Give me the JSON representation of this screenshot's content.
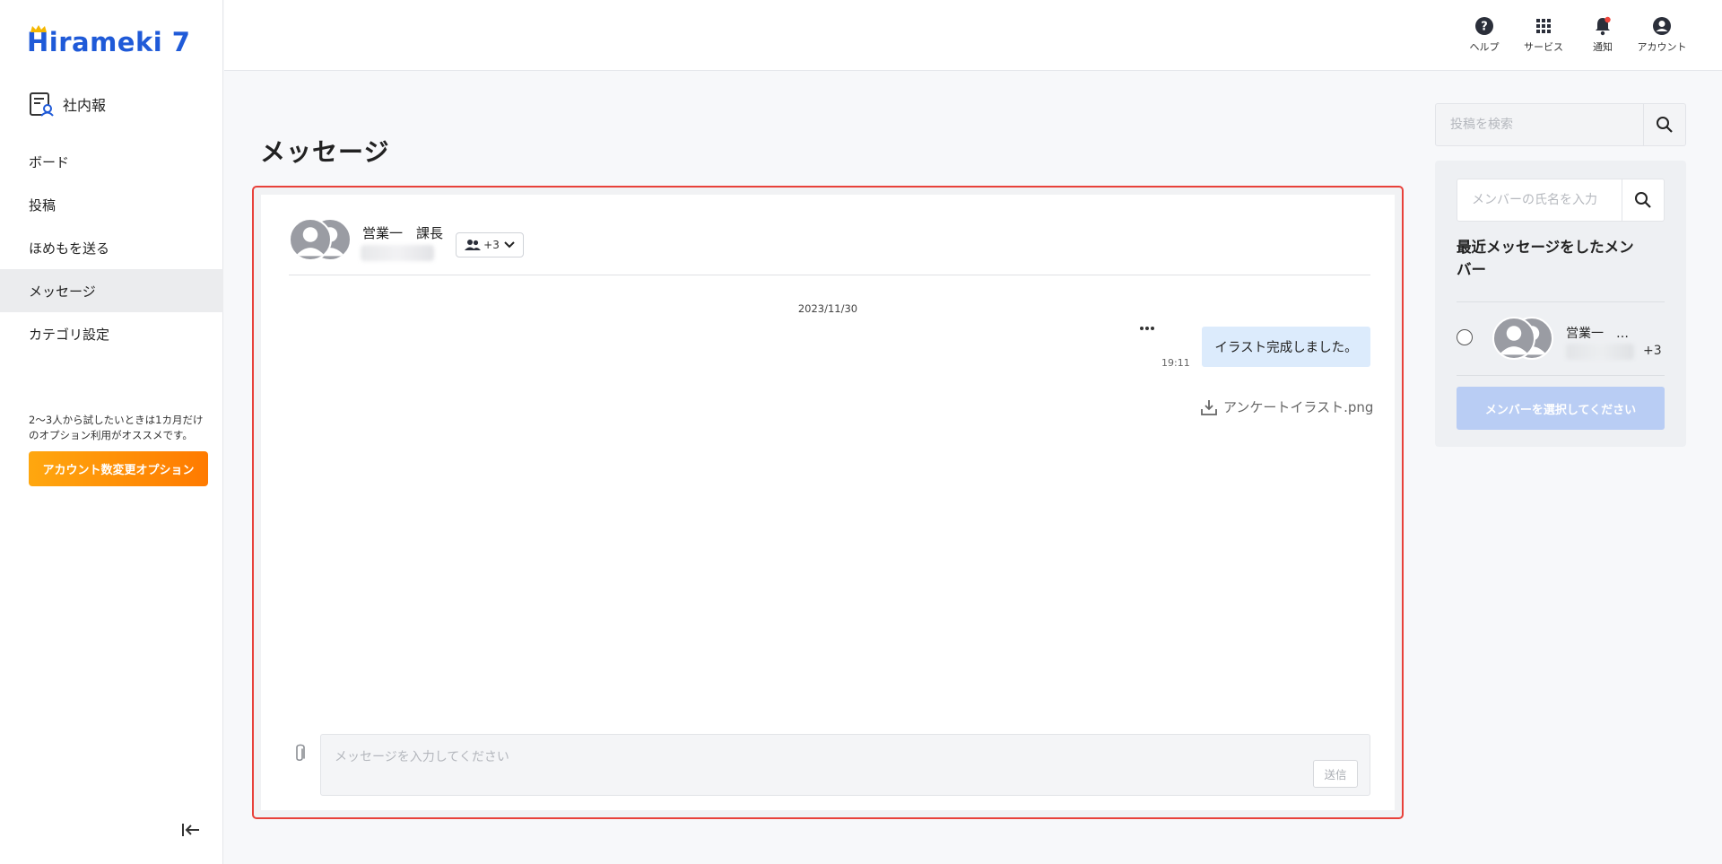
{
  "app": {
    "logo_text": "Hirameki 7",
    "product_name": "社内報"
  },
  "sidebar": {
    "items": [
      {
        "label": "ボード",
        "active": false
      },
      {
        "label": "投稿",
        "active": false
      },
      {
        "label": "ほめもを送る",
        "active": false
      },
      {
        "label": "メッセージ",
        "active": true
      },
      {
        "label": "カテゴリ設定",
        "active": false
      }
    ],
    "promo_text": "2〜3人から試したいときは1カ月だけのオプション利用がオススメです。",
    "promo_button": "アカウント数変更オプション",
    "collapse_icon": "collapse-left-icon"
  },
  "header": {
    "icons": [
      {
        "icon": "help-icon",
        "label": "ヘルプ"
      },
      {
        "icon": "grid-icon",
        "label": "サービス"
      },
      {
        "icon": "bell-icon",
        "label": "通知",
        "has_badge": true
      },
      {
        "icon": "account-icon",
        "label": "アカウント"
      }
    ]
  },
  "main": {
    "title": "メッセージ",
    "chat": {
      "participant_name": "営業一　課長",
      "members_count": "+3",
      "date": "2023/11/30",
      "messages": [
        {
          "text": "イラスト完成しました。",
          "time": "19:11",
          "attachment": "アンケートイラスト.png"
        }
      ],
      "input_placeholder": "メッセージを入力してください",
      "send_label": "送信"
    }
  },
  "right": {
    "post_search_placeholder": "投稿を検索",
    "member_search_placeholder": "メンバーの氏名を入力",
    "recent_title": "最近メッセージをしたメンバー",
    "recent_members": [
      {
        "name": "営業一　…",
        "extra": "+3"
      }
    ],
    "select_button": "メンバーを選択してください"
  },
  "colors": {
    "brand": "#1f5ad8",
    "promo_orange": "#ff8a00",
    "highlight_border": "#e8413a",
    "bubble": "#dcebfc",
    "select_button_disabled": "#b9cdf4"
  }
}
